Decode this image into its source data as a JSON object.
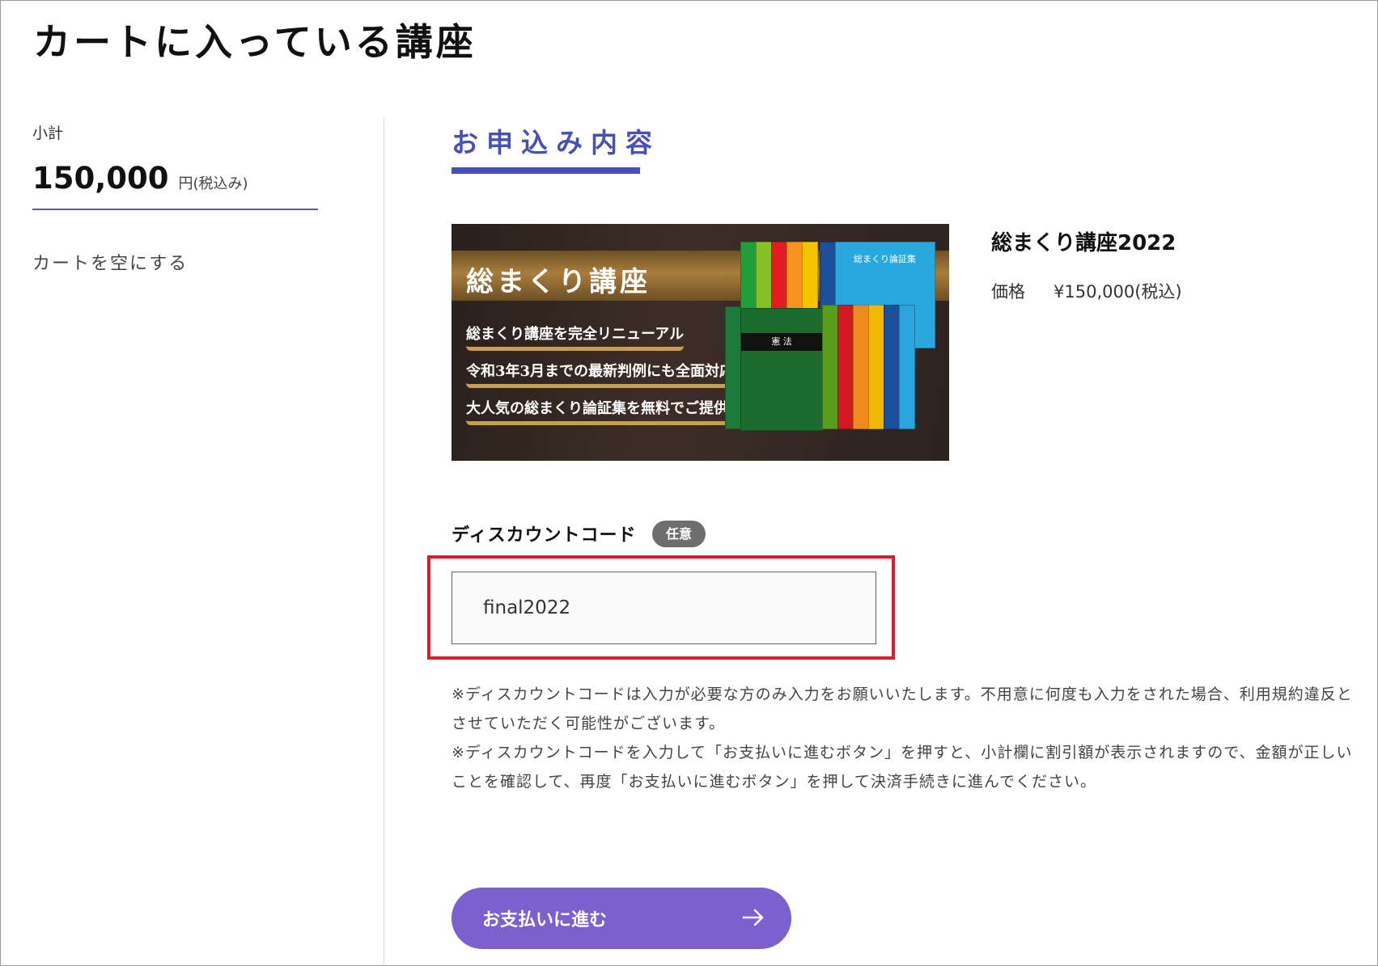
{
  "page": {
    "title": "カートに入っている講座"
  },
  "sidebar": {
    "subtotal_label": "小計",
    "subtotal_amount": "150,000",
    "subtotal_unit": "円(税込み)",
    "empty_cart_label": "カートを空にする"
  },
  "order": {
    "section_title": "お申込み内容",
    "product_name": "総まくり講座2022",
    "price_label": "価格",
    "price_value": "¥150,000(税込)"
  },
  "banner": {
    "title": "総まくり講座",
    "lines": [
      "総まくり講座を完全リニューアル",
      "令和3年3月までの最新判例にも全面対応",
      "大人気の総まくり論証集を無料でご提供"
    ],
    "book_cover_text": "総まくり論証集",
    "book_label": "憲 法"
  },
  "discount": {
    "label": "ディスカウントコード",
    "badge": "任意",
    "value": "final2022"
  },
  "notes": [
    "※ディスカウントコードは入力が必要な方のみ入力をお願いいたします。不用意に何度も入力をされた場合、利用規約違反とさせていただく可能性がございます。",
    "※ディスカウントコードを入力して「お支払いに進むボタン」を押すと、小計欄に割引額が表示されますので、金額が正しいことを確認して、再度「お支払いに進むボタン」を押して決済手続きに進んでください。"
  ],
  "actions": {
    "pay_label": "お支払いに進む"
  },
  "colors": {
    "accent": "#4651b5",
    "button": "#7d60d0",
    "highlight": "#d4202a",
    "badge": "#6e6e6e"
  }
}
